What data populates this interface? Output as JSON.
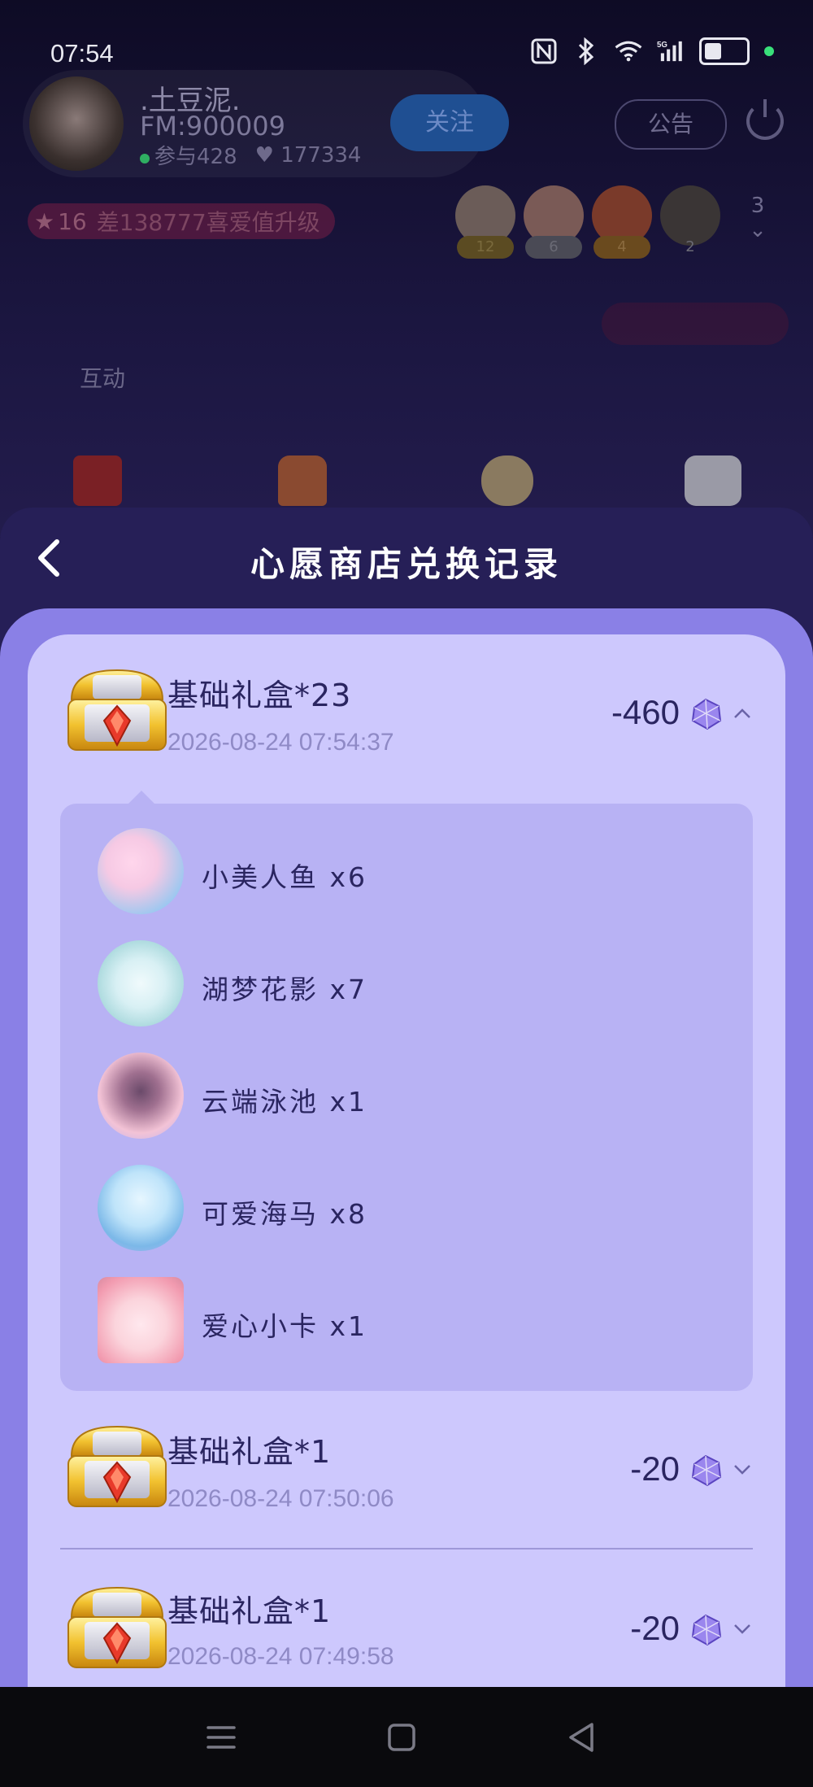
{
  "status_bar": {
    "time": "07:54",
    "icons": [
      "nfc-icon",
      "bluetooth-icon",
      "wifi-icon",
      "5g-signal-icon",
      "battery-icon"
    ]
  },
  "background_room": {
    "host": {
      "name": ".土豆泥.",
      "fm": "FM:900009",
      "participants": "参与428",
      "likes": "177334",
      "follow_label": "关注"
    },
    "notice_label": "公告",
    "level": {
      "badge": "16",
      "text": "差138777喜爱值升级"
    },
    "viewers": [
      {
        "badge": "12",
        "color": "#6b5c58"
      },
      {
        "badge": "6",
        "color": "#7a5a56"
      },
      {
        "badge": "4",
        "color": "#7a3a2a"
      },
      {
        "badge": "2",
        "color": "#3a3535"
      }
    ],
    "viewer_count": "3",
    "interact_label": "互动"
  },
  "sheet": {
    "title": "心愿商店兑换记录",
    "back_icon": "chevron-left-icon"
  },
  "records": [
    {
      "title": "基础礼盒*23",
      "date": "2026-08-24 07:54:37",
      "amount": "-460",
      "expanded": true,
      "gifts": [
        {
          "label": "小美人鱼 x6",
          "color_a": "#f6c9e4",
          "color_b": "#9cc8f0"
        },
        {
          "label": "湖梦花影 x7",
          "color_a": "#d8f0f4",
          "color_b": "#a8d8dc"
        },
        {
          "label": "云端泳池 x1",
          "color_a": "#f3c3d6",
          "color_b": "#6a4a6a"
        },
        {
          "label": "可爱海马 x8",
          "color_a": "#bfe4fa",
          "color_b": "#7bb8e8"
        },
        {
          "label": "爱心小卡 x1",
          "color_a": "#fbd4dc",
          "color_b": "#f29bb0"
        }
      ]
    },
    {
      "title": "基础礼盒*1",
      "date": "2026-08-24 07:50:06",
      "amount": "-20",
      "expanded": false
    },
    {
      "title": "基础礼盒*1",
      "date": "2026-08-24 07:49:58",
      "amount": "-20",
      "expanded": false
    }
  ],
  "nav_bar": {
    "icons": [
      "menu-icon",
      "home-square-icon",
      "back-triangle-icon"
    ]
  },
  "colors": {
    "sheet_bg": "#261f57",
    "card_bg": "#cdc8fd",
    "detail_bg": "#b8b2f4",
    "text_primary": "#2a2560",
    "text_date": "#8f8ac6"
  }
}
